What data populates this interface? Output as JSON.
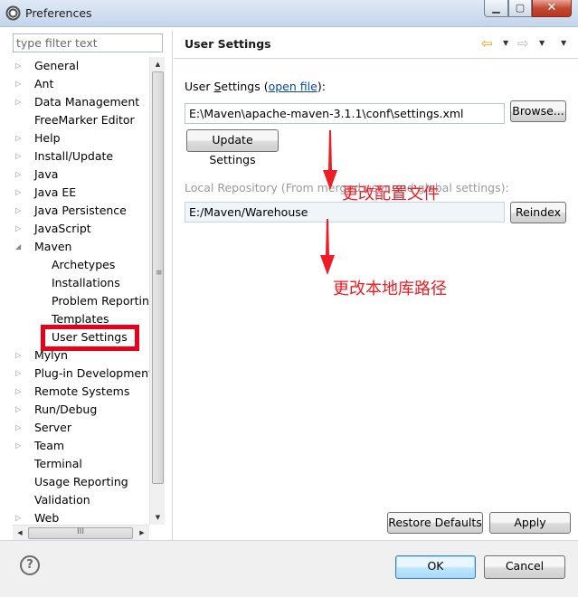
{
  "window": {
    "title": "Preferences",
    "min_glyph": "▁",
    "max_glyph": "▢",
    "close_glyph": "✕"
  },
  "filter": {
    "placeholder": "type filter text"
  },
  "tree": {
    "items": [
      {
        "label": "General",
        "expander": "▷"
      },
      {
        "label": "Ant",
        "expander": "▷"
      },
      {
        "label": "Data Management",
        "expander": "▷"
      },
      {
        "label": "FreeMarker Editor",
        "expander": ""
      },
      {
        "label": "Help",
        "expander": "▷"
      },
      {
        "label": "Install/Update",
        "expander": "▷"
      },
      {
        "label": "Java",
        "expander": "▷"
      },
      {
        "label": "Java EE",
        "expander": "▷"
      },
      {
        "label": "Java Persistence",
        "expander": "▷"
      },
      {
        "label": "JavaScript",
        "expander": "▷"
      },
      {
        "label": "Maven",
        "expander": "◢"
      },
      {
        "label": "Archetypes",
        "expander": ""
      },
      {
        "label": "Installations",
        "expander": ""
      },
      {
        "label": "Problem Reporting",
        "expander": ""
      },
      {
        "label": "Templates",
        "expander": ""
      },
      {
        "label": "User Settings",
        "expander": ""
      },
      {
        "label": "Mylyn",
        "expander": "▷"
      },
      {
        "label": "Plug-in Development",
        "expander": "▷"
      },
      {
        "label": "Remote Systems",
        "expander": "▷"
      },
      {
        "label": "Run/Debug",
        "expander": "▷"
      },
      {
        "label": "Server",
        "expander": "▷"
      },
      {
        "label": "Team",
        "expander": "▷"
      },
      {
        "label": "Terminal",
        "expander": ""
      },
      {
        "label": "Usage Reporting",
        "expander": ""
      },
      {
        "label": "Validation",
        "expander": ""
      },
      {
        "label": "Web",
        "expander": "▷"
      }
    ],
    "selected": "User Settings"
  },
  "scroll": {
    "up": "▲",
    "down": "▼",
    "left": "◀",
    "right": "▶",
    "vgrip": "≡",
    "hgrip": "III"
  },
  "page": {
    "title": "User Settings",
    "nav_back": "⇦",
    "nav_forward": "⇨",
    "dropdown": "▼"
  },
  "user_settings": {
    "label_prefix": "User ",
    "label_mnemonic": "S",
    "label_rest": "ettings (",
    "link": "open file",
    "label_suffix": "):",
    "path": "E:\\Maven\\apache-maven-3.1.1\\conf\\settings.xml",
    "browse": "Browse...",
    "update": "Update Settings"
  },
  "local_repo": {
    "label": "Local Repository (From merged user and global settings):",
    "value": "E:/Maven/Warehouse",
    "reindex": "Reindex"
  },
  "annotations": {
    "config_note": "更改配置文件",
    "repo_note": "更改本地库路径",
    "color": "#ee1c25"
  },
  "actions": {
    "restore_defaults": "Restore Defaults",
    "apply": "Apply",
    "ok": "OK",
    "cancel": "Cancel",
    "help": "?"
  }
}
